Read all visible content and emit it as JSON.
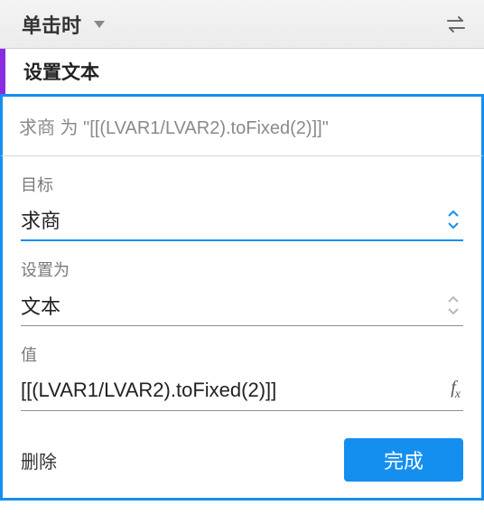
{
  "header": {
    "event_label": "单击时"
  },
  "action": {
    "title": "设置文本",
    "summary": "求商 为 \"[[(LVAR1/LVAR2).toFixed(2)]]\""
  },
  "fields": {
    "target": {
      "label": "目标",
      "value": "求商"
    },
    "setAs": {
      "label": "设置为",
      "value": "文本"
    },
    "value": {
      "label": "值",
      "value": "[[(LVAR1/LVAR2).toFixed(2)]]"
    }
  },
  "footer": {
    "delete": "删除",
    "done": "完成"
  }
}
